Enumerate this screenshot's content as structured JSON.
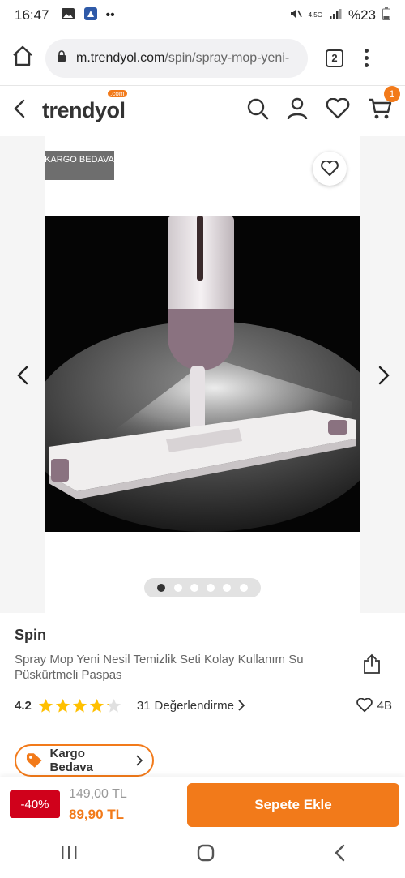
{
  "status_bar": {
    "time": "16:47",
    "network": "4.5G",
    "battery": "%23"
  },
  "browser": {
    "url_domain": "m.trendyol.com",
    "url_path": "/spin/spray-mop-yeni-",
    "tab_count": "2"
  },
  "header": {
    "logo_text": "trendyol",
    "logo_suffix": ".com",
    "cart_badge": "1"
  },
  "gallery": {
    "tag": "KARGO BEDAVA",
    "dots_count": 6,
    "active_dot": 1
  },
  "product": {
    "brand": "Spin",
    "name": "Spray Mop Yeni Nesil Temizlik Seti Kolay Kullanım Su Püskürtmeli Paspas",
    "rating": "4.2",
    "stars_filled": 4,
    "review_count": "31",
    "review_label": "Değerlendirme",
    "favorites": "4B",
    "shipping_label": "Kargo Bedava"
  },
  "purchase": {
    "discount": "-40%",
    "old_price": "149,00 TL",
    "new_price": "89,90 TL",
    "add_to_cart": "Sepete Ekle"
  },
  "colors": {
    "brand": "#f27a1a",
    "discount": "#d0011b",
    "star": "#ffc000"
  }
}
